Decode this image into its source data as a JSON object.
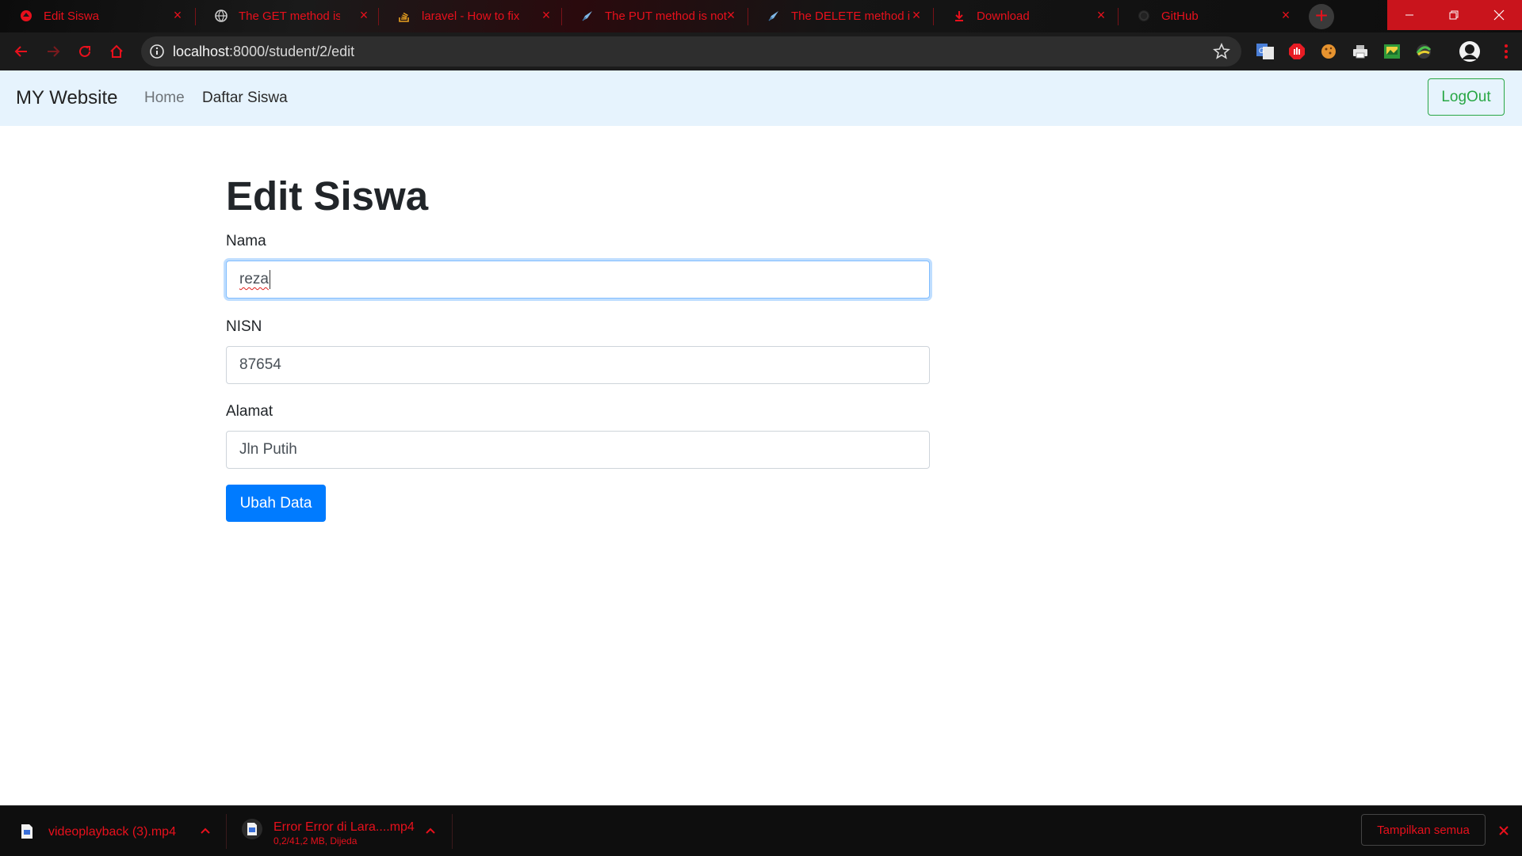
{
  "browser": {
    "tabs": [
      {
        "title": "Edit Siswa",
        "icon": "laravel-icon"
      },
      {
        "title": "The GET method is",
        "icon": "globe-icon"
      },
      {
        "title": "laravel - How to fix \"Th",
        "icon": "stackoverflow-icon"
      },
      {
        "title": "The PUT method is not",
        "icon": "rocket-icon"
      },
      {
        "title": "The DELETE method is",
        "icon": "rocket-icon"
      },
      {
        "title": "Download",
        "icon": "download-icon"
      },
      {
        "title": "GitHub",
        "icon": "github-icon"
      }
    ],
    "address_host": "localhost",
    "address_rest": ":8000/student/2/edit",
    "accent": "#e8101c"
  },
  "navbar": {
    "brand": "MY Website",
    "links": [
      "Home",
      "Daftar Siswa"
    ],
    "logout": "LogOut"
  },
  "form": {
    "heading": "Edit Siswa",
    "nama_label": "Nama",
    "nama_value": "reza",
    "nisn_label": "NISN",
    "nisn_value": "87654",
    "alamat_label": "Alamat",
    "alamat_value": "Jln Putih",
    "submit": "Ubah Data"
  },
  "downloads": {
    "items": [
      {
        "name": "videoplayback (3).mp4",
        "status": ""
      },
      {
        "name": "Error Error di Lara....mp4",
        "status": "0,2/41,2 MB, Dijeda"
      }
    ],
    "show_all": "Tampilkan semua"
  }
}
